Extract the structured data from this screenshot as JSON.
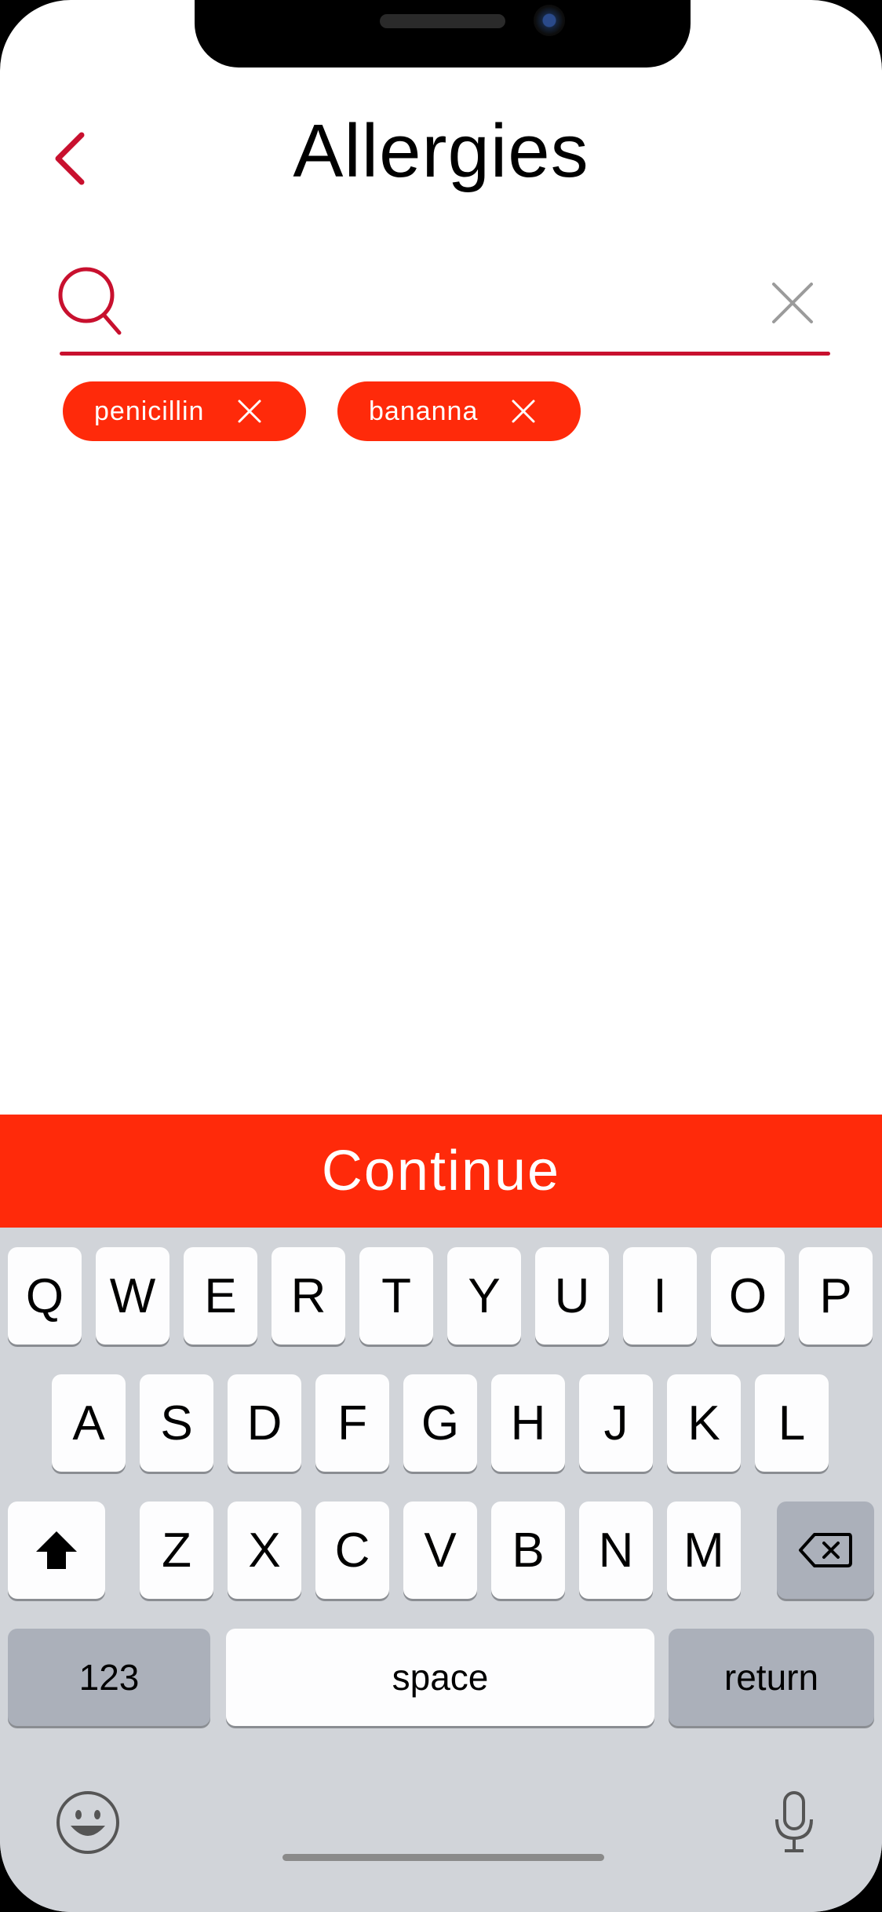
{
  "header": {
    "title": "Allergies",
    "back_icon": "chevron-left-icon"
  },
  "search": {
    "value": "",
    "placeholder": "",
    "search_icon": "search-icon",
    "clear_icon": "close-icon"
  },
  "chips": [
    {
      "label": "penicillin",
      "remove_icon": "close-icon"
    },
    {
      "label": "bananna",
      "remove_icon": "close-icon"
    }
  ],
  "continue_label": "Continue",
  "keyboard": {
    "row1": [
      "Q",
      "W",
      "E",
      "R",
      "T",
      "Y",
      "U",
      "I",
      "O",
      "P"
    ],
    "row2": [
      "A",
      "S",
      "D",
      "F",
      "G",
      "H",
      "J",
      "K",
      "L"
    ],
    "row3": [
      "Z",
      "X",
      "C",
      "V",
      "B",
      "N",
      "M"
    ],
    "numbers_label": "123",
    "space_label": "space",
    "return_label": "return",
    "shift_icon": "shift-icon",
    "delete_icon": "backspace-icon",
    "emoji_icon": "emoji-icon",
    "mic_icon": "microphone-icon"
  },
  "colors": {
    "accent": "#c8102e",
    "chip": "#ff2a0a",
    "button": "#ff2a0a",
    "keyboard_bg": "#d1d4d9"
  }
}
